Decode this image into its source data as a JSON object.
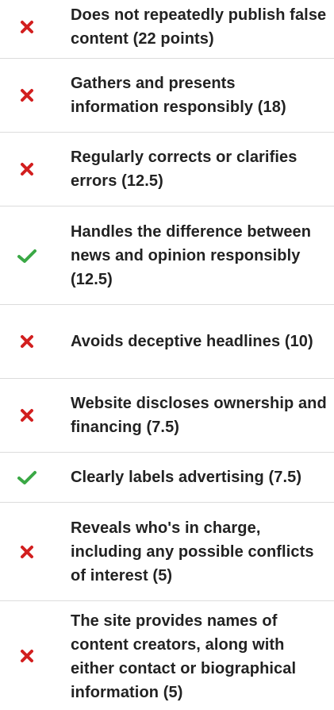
{
  "colors": {
    "fail": "#d21f1f",
    "pass": "#3aa845",
    "divider": "#dcdcdc",
    "text": "#222222"
  },
  "criteria": [
    {
      "label": "Does not repeatedly publish false content (22 points)",
      "status": "fail",
      "icon": "x-icon"
    },
    {
      "label": "Gathers and presents information responsibly (18)",
      "status": "fail",
      "icon": "x-icon"
    },
    {
      "label": "Regularly corrects or clarifies errors (12.5)",
      "status": "fail",
      "icon": "x-icon"
    },
    {
      "label": "Handles the difference between news and opinion responsibly (12.5)",
      "status": "pass",
      "icon": "checkmark-icon"
    },
    {
      "label": "Avoids deceptive headlines (10)",
      "status": "fail",
      "icon": "x-icon"
    },
    {
      "label": "Website discloses ownership and financing (7.5)",
      "status": "fail",
      "icon": "x-icon"
    },
    {
      "label": "Clearly labels advertising (7.5)",
      "status": "pass",
      "icon": "checkmark-icon"
    },
    {
      "label": "Reveals who's in charge, including any possible conflicts of interest (5)",
      "status": "fail",
      "icon": "x-icon"
    },
    {
      "label": "The site provides names of content creators, along with either contact or biographical information (5)",
      "status": "fail",
      "icon": "x-icon"
    }
  ]
}
